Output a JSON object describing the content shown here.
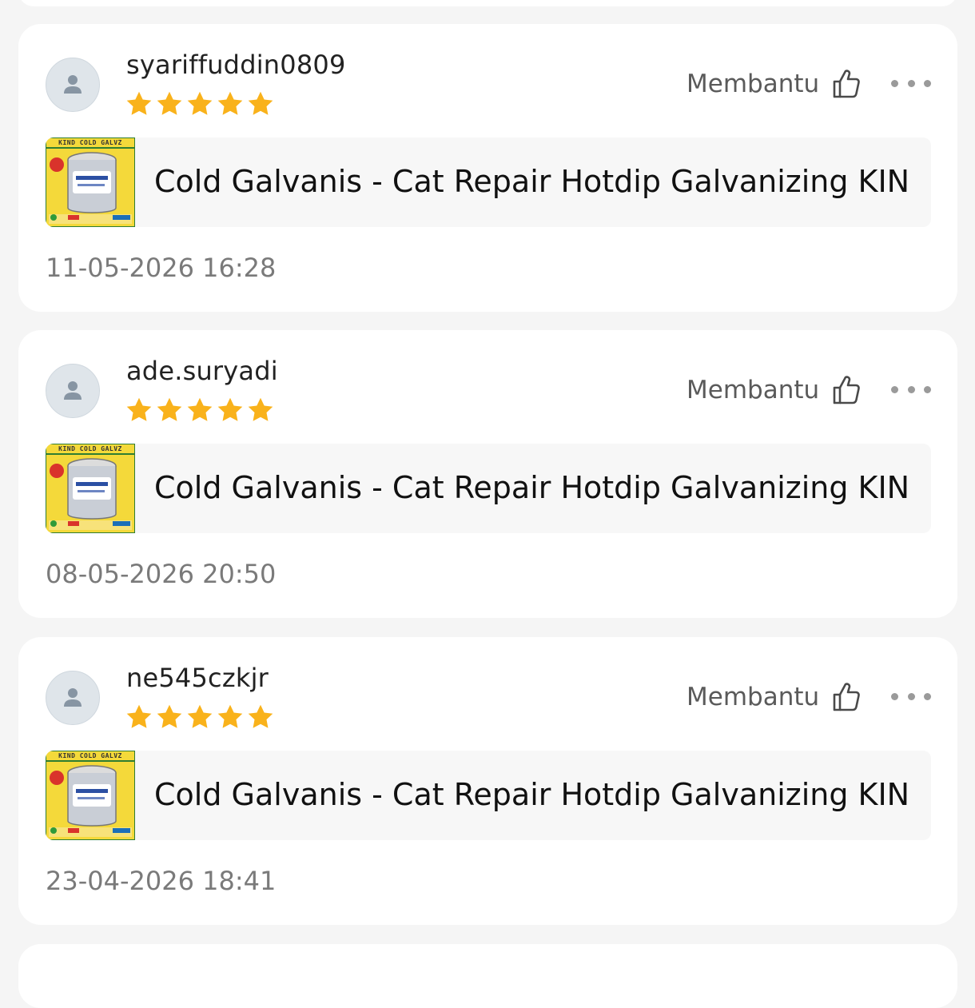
{
  "reviews": [
    {
      "username": "syariffuddin0809",
      "rating": 5,
      "helpful_label": "Membantu",
      "product_title": "Cold Galvanis - Cat Repair Hotdip Galvanizing  KIN...",
      "product_image_text": "KIND COLD GALVZ",
      "date": "11-05-2026 16:28"
    },
    {
      "username": "ade.suryadi",
      "rating": 5,
      "helpful_label": "Membantu",
      "product_title": "Cold Galvanis - Cat Repair Hotdip Galvanizing  KIN...",
      "product_image_text": "KIND COLD GALVZ",
      "date": "08-05-2026 20:50"
    },
    {
      "username": "ne545czkjr",
      "rating": 5,
      "helpful_label": "Membantu",
      "product_title": "Cold Galvanis - Cat Repair Hotdip Galvanizing  KIN...",
      "product_image_text": "KIND COLD GALVZ",
      "date": "23-04-2026 18:41"
    }
  ],
  "icons": {
    "avatar": "user-avatar-icon",
    "star": "star-icon",
    "helpful": "thumbs-up-icon",
    "more": "more-options-icon"
  },
  "colors": {
    "star": "#F9B21B",
    "background": "#F5F5F5",
    "card": "#FFFFFF",
    "product_bg": "#F7F7F7",
    "thumb": "#F4D93A"
  }
}
